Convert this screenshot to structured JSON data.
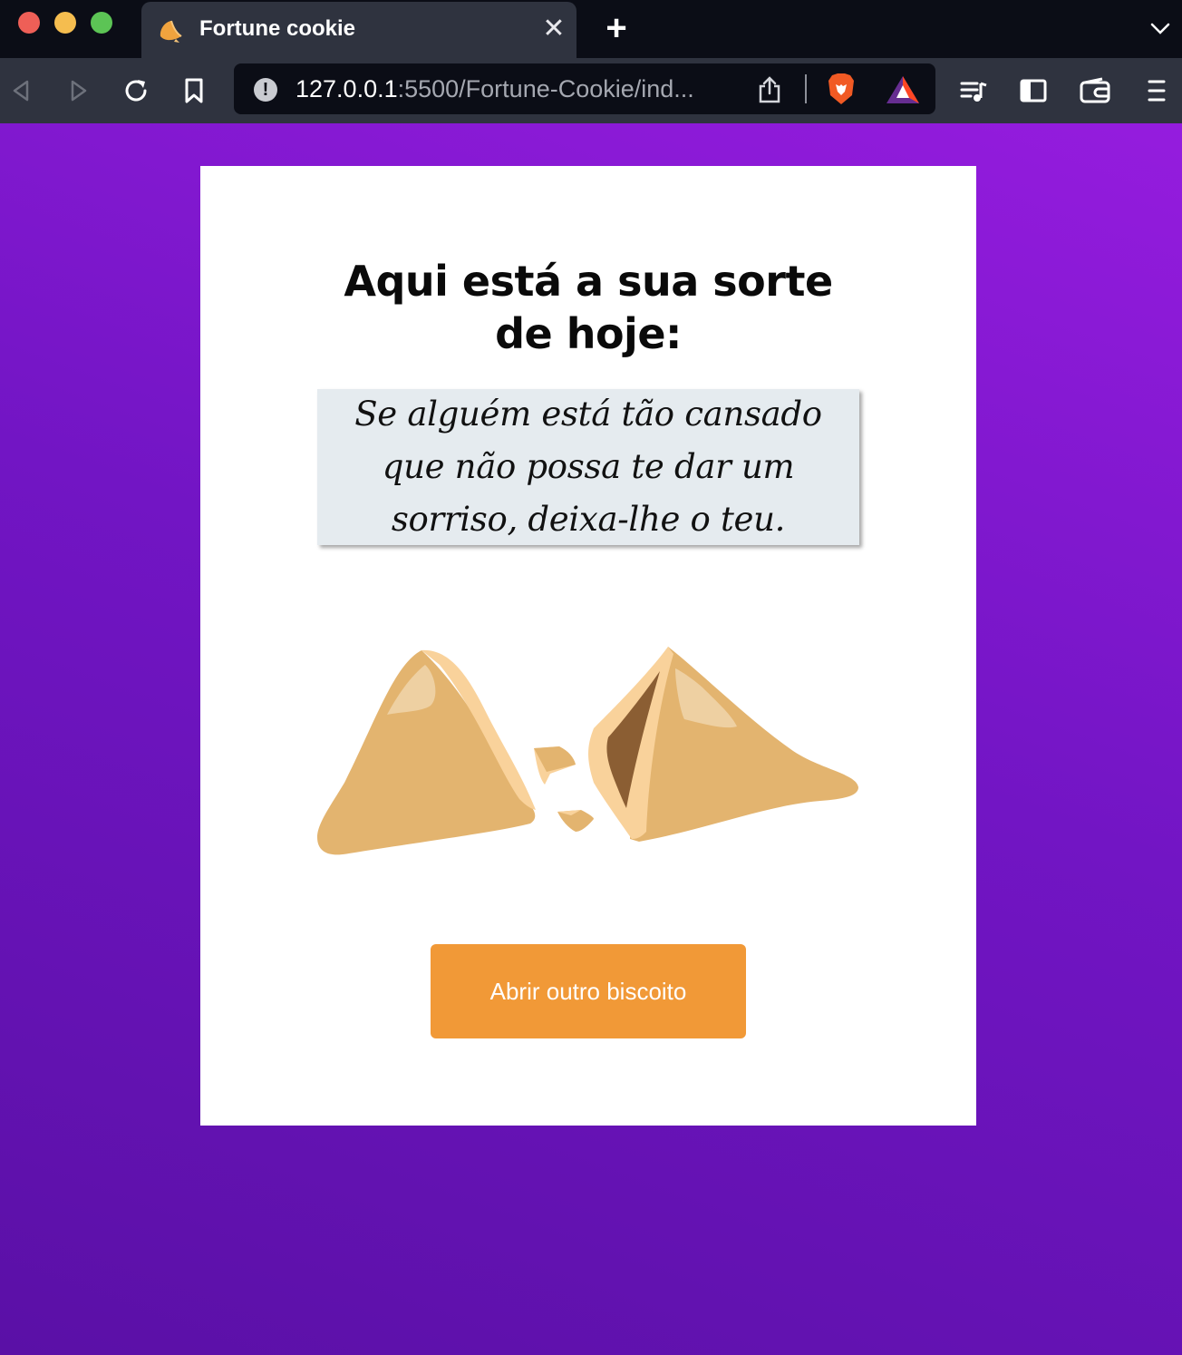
{
  "browser": {
    "tab": {
      "title": "Fortune cookie",
      "favicon": "fortune-cookie-icon"
    },
    "address_bar": {
      "host": "127.0.0.1",
      "rest": ":5500/Fortune-Cookie/ind..."
    },
    "icons": [
      "back-icon",
      "forward-icon",
      "reload-icon",
      "bookmark-icon",
      "site-info-icon",
      "share-icon",
      "brave-shields-icon",
      "brave-rewards-icon",
      "playlist-icon",
      "sidebar-icon",
      "wallet-icon",
      "menu-icon"
    ]
  },
  "page": {
    "heading": "Aqui está a sua sorte de hoje:",
    "fortune": "Se alguém está tão cansado que não possa te dar um sorriso, deixa-lhe o teu.",
    "button_label": "Abrir outro biscoito"
  },
  "colors": {
    "background_gradient": [
      "#951cde",
      "#5a10a6"
    ],
    "card": "#ffffff",
    "fortune_box": "#e5ebef",
    "button": "#f19937",
    "cookie": "#e3b46f"
  }
}
